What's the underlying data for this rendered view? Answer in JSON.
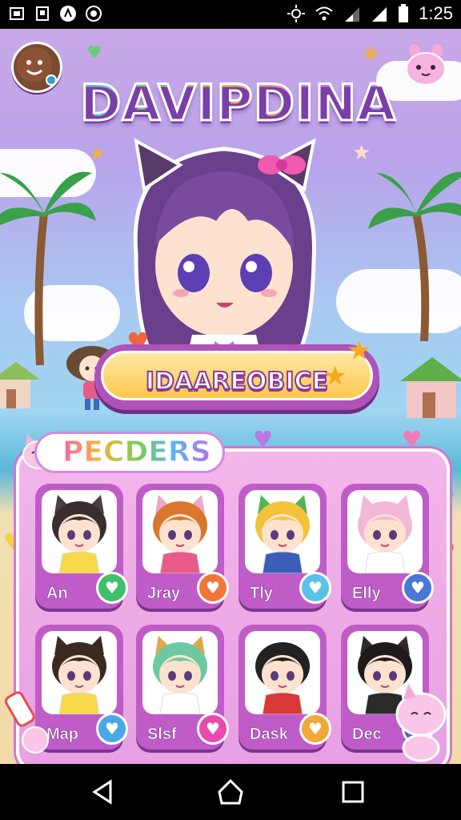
{
  "status_bar": {
    "time": "1:25",
    "left_icons": [
      "screen-icon",
      "sd-card-icon",
      "app-icon",
      "sync-icon"
    ],
    "right_icons": [
      "brightness-icon",
      "wifi-icon",
      "signal-icon",
      "signal-full-icon",
      "battery-icon"
    ]
  },
  "game": {
    "title": "DAVIPDINA",
    "featured_character_name": "IDAAREOBICE",
    "section_title": "PECDERS",
    "characters": [
      {
        "name": "An",
        "hair": "#3a2f2f",
        "outfit": "#f7d94a",
        "heart_color": "#3fbf6a",
        "ears": "#4a4040"
      },
      {
        "name": "Jray",
        "hair": "#d9772f",
        "outfit": "#e85a8a",
        "heart_color": "#f0763a",
        "ears": "#f0a6c9"
      },
      {
        "name": "Tly",
        "hair": "#f2c33a",
        "outfit": "#3b5fb8",
        "heart_color": "#5ac2e8",
        "ears": "#54b35a"
      },
      {
        "name": "Elly",
        "hair": "#f2b8d8",
        "outfit": "#ffffff",
        "heart_color": "#4a78d8",
        "ears": "#f2b8d8"
      },
      {
        "name": "Map",
        "hair": "#3b2a22",
        "outfit": "#f7d94a",
        "heart_color": "#4aa8e8",
        "ears": "#3b2a22"
      },
      {
        "name": "Slsf",
        "hair": "#6cc9a0",
        "outfit": "#ffffff",
        "heart_color": "#e84ab0",
        "ears": "#e3a547"
      },
      {
        "name": "Dask",
        "hair": "#222222",
        "outfit": "#d93838",
        "heart_color": "#f2a93a",
        "ears": "#ffffff"
      },
      {
        "name": "Dec",
        "hair": "#1e1a1a",
        "outfit": "#2a2a2a",
        "heart_color": "#4a5fd8",
        "ears": "#2c2c2c"
      }
    ]
  },
  "nav_bar": {
    "icons": [
      "back-icon",
      "home-icon",
      "recents-icon"
    ]
  },
  "colors": {
    "panel": "#ef aee6",
    "banner": "#ffc74d",
    "accent_purple": "#b052b8"
  }
}
